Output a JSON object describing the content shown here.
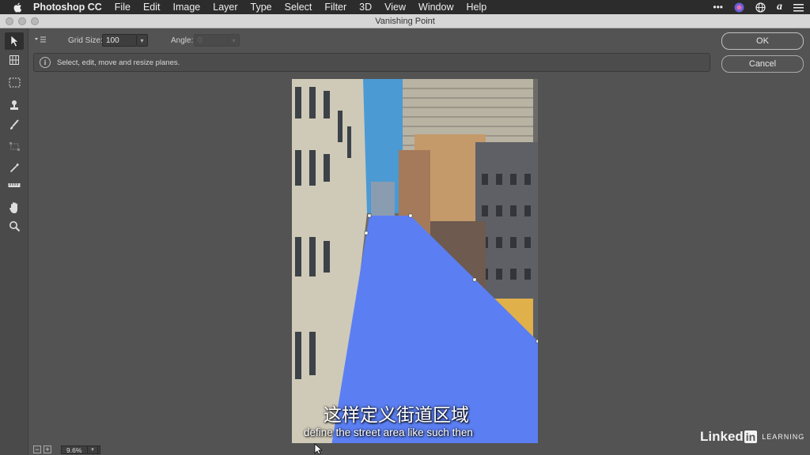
{
  "menubar": {
    "app": "Photoshop CC",
    "items": [
      "File",
      "Edit",
      "Image",
      "Layer",
      "Type",
      "Select",
      "Filter",
      "3D",
      "View",
      "Window",
      "Help"
    ],
    "right_icons": [
      "more-icon",
      "siri-icon",
      "globe-icon",
      "font-icon",
      "list-icon"
    ]
  },
  "window": {
    "title": "Vanishing Point"
  },
  "tools": [
    "edit-plane-tool-icon",
    "create-plane-tool-icon",
    "marquee-tool-icon",
    "stamp-tool-icon",
    "brush-tool-icon",
    "transform-tool-icon",
    "eyedropper-tool-icon",
    "measure-tool-icon",
    "hand-tool-icon",
    "zoom-tool-icon"
  ],
  "options": {
    "grid_size_label": "Grid Size:",
    "grid_size_value": "100",
    "angle_label": "Angle:",
    "angle_value": "0"
  },
  "info": {
    "message": "Select, edit, move and resize planes."
  },
  "buttons": {
    "ok": "OK",
    "cancel": "Cancel"
  },
  "zoom": {
    "value": "9.6%",
    "minus": "−",
    "plus": "+"
  },
  "subtitle": {
    "chinese": "这样定义街道区域",
    "english": "define the street area like such then"
  },
  "watermark": {
    "brand_a": "Linked",
    "brand_b": "in",
    "suffix": "LEARNING"
  },
  "colors": {
    "plane_fill": "#5b7ff2",
    "sky": "#4b9ad4",
    "ui_bg": "#535353"
  }
}
